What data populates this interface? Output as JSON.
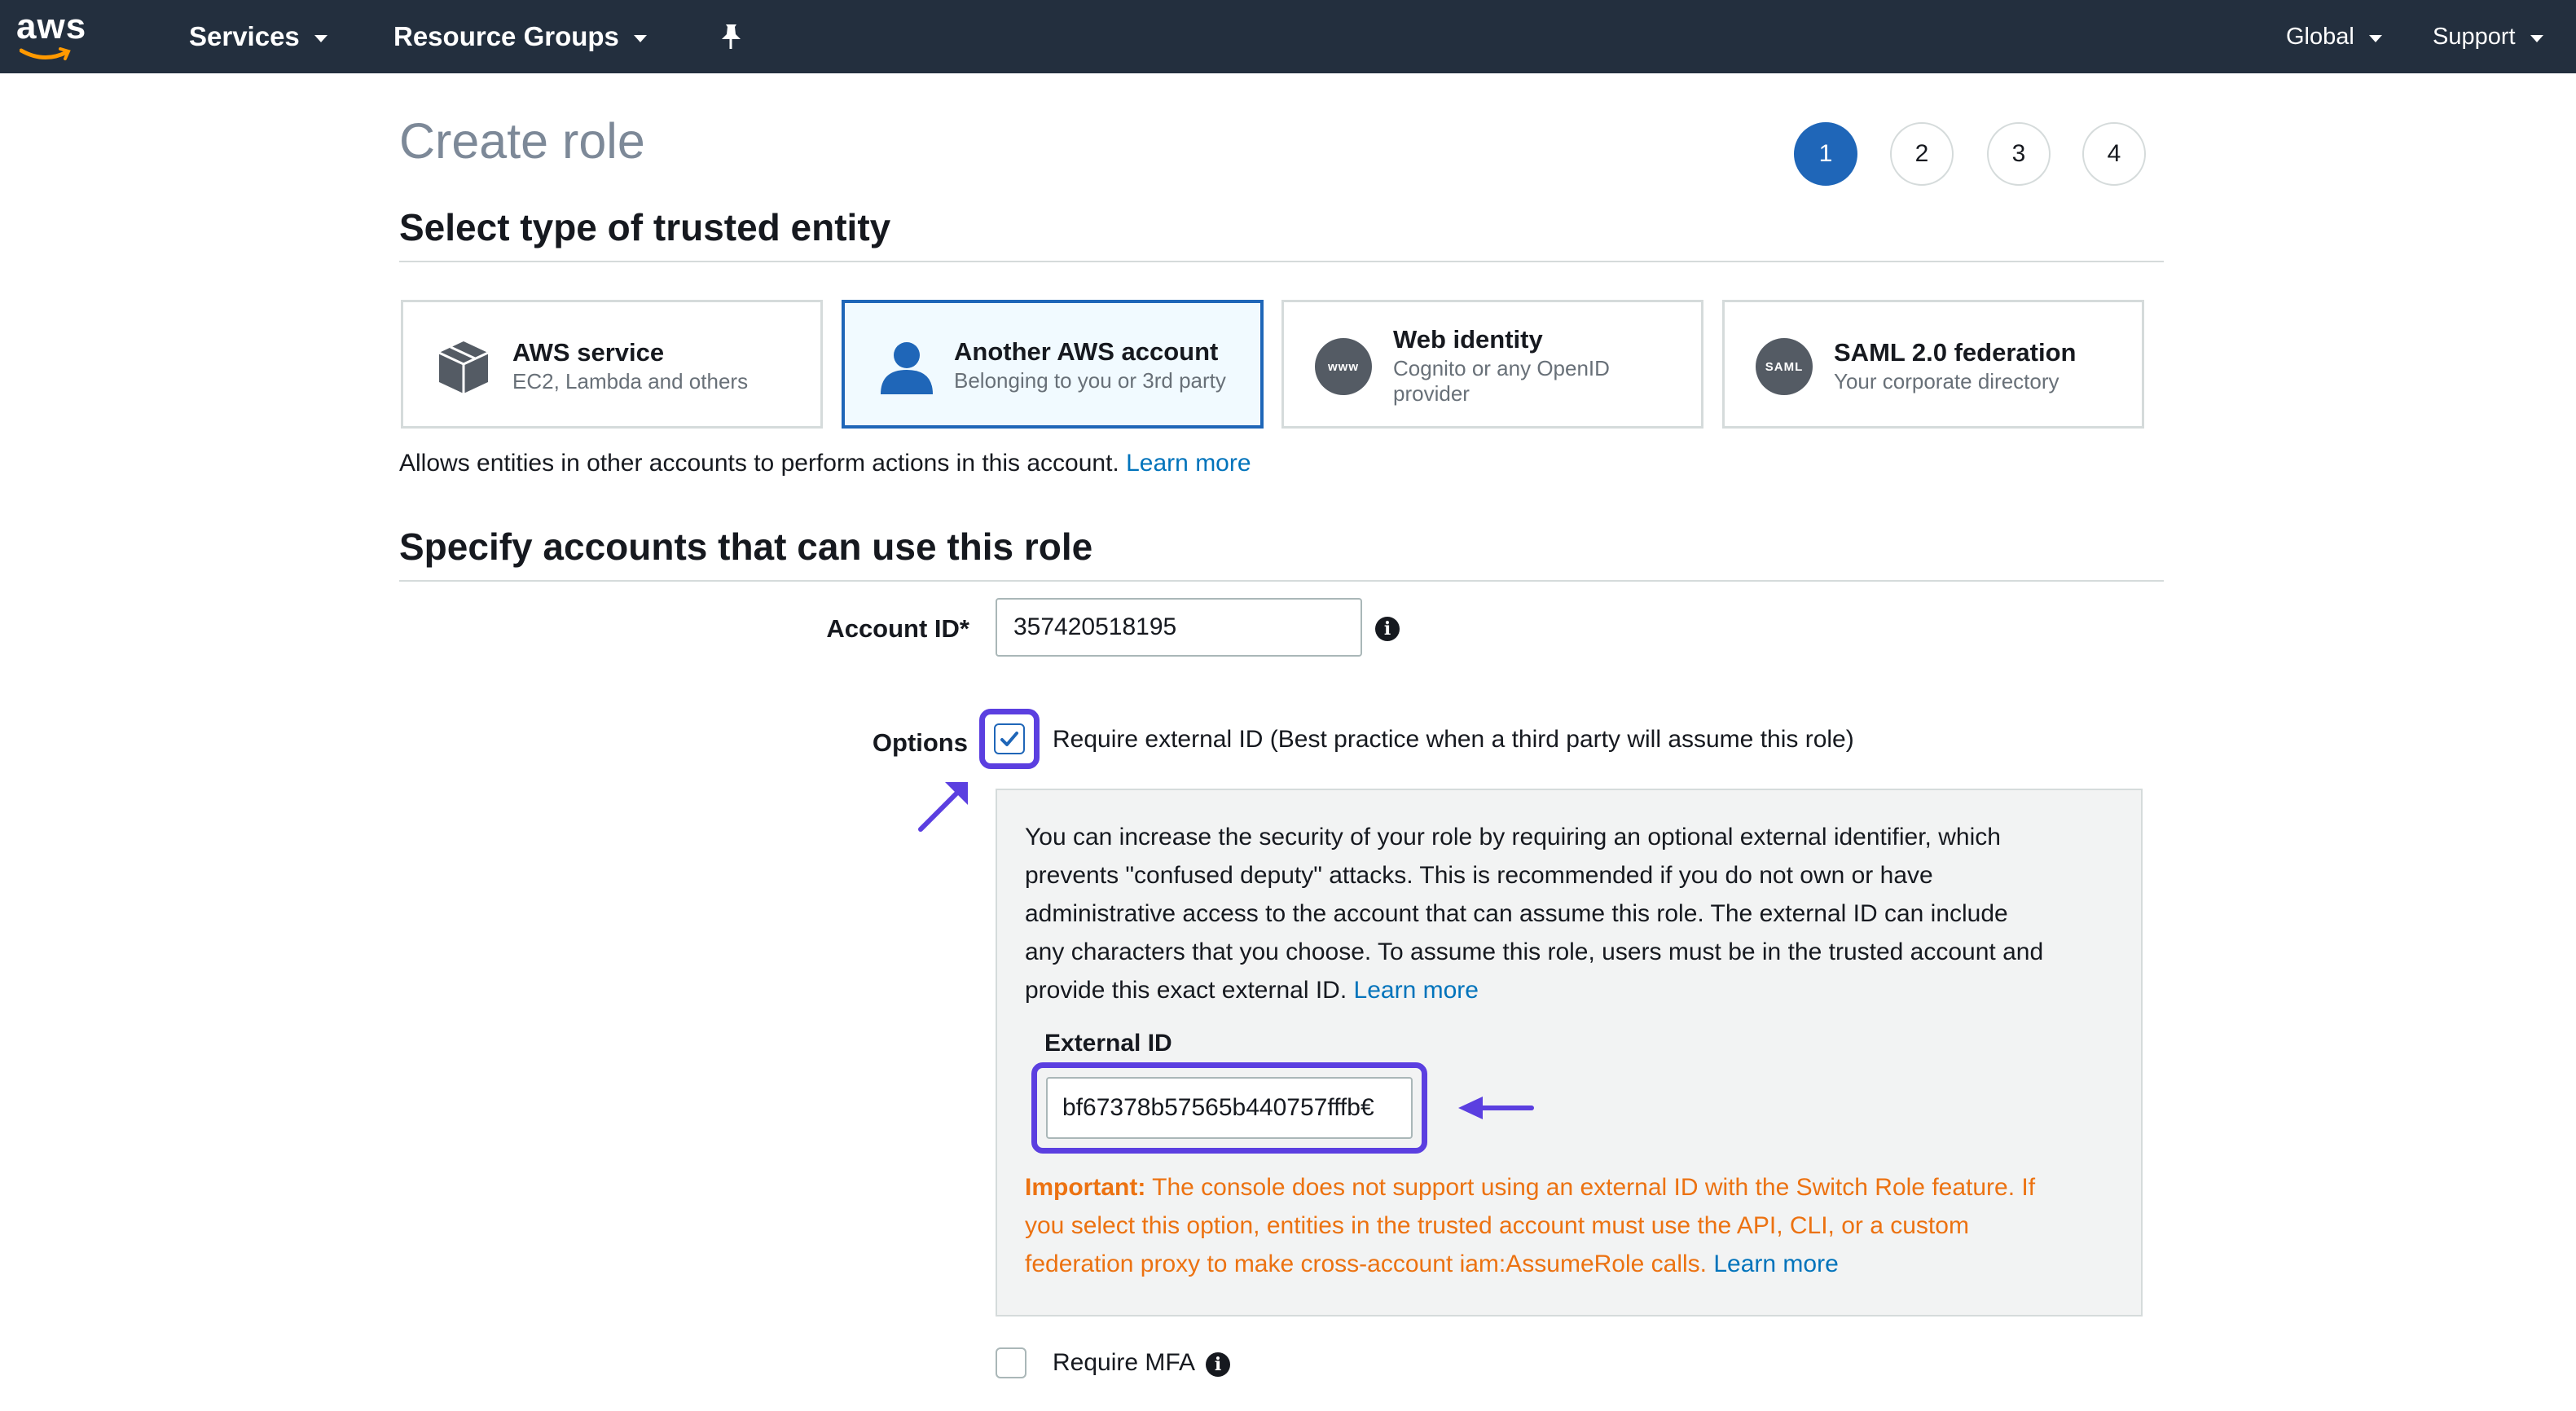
{
  "nav": {
    "logo": "aws",
    "services": "Services",
    "resource_groups": "Resource Groups",
    "pin_icon": "pin-icon",
    "global": "Global",
    "support": "Support"
  },
  "page": {
    "title": "Create role",
    "steps": [
      "1",
      "2",
      "3",
      "4"
    ],
    "active_step": "1"
  },
  "trusted_entity": {
    "heading": "Select type of trusted entity",
    "cards": [
      {
        "title": "AWS service",
        "subtitle": "EC2, Lambda and others",
        "icon": "cube-icon"
      },
      {
        "title": "Another AWS account",
        "subtitle": "Belonging to you or 3rd party",
        "icon": "user-icon"
      },
      {
        "title": "Web identity",
        "subtitle_line1": "Cognito or any OpenID",
        "subtitle_line2": "provider",
        "icon": "www-icon",
        "icon_text": "www"
      },
      {
        "title": "SAML 2.0 federation",
        "subtitle": "Your corporate directory",
        "icon": "saml-icon",
        "icon_text": "SAML"
      }
    ],
    "selected": "Another AWS account",
    "description": "Allows entities in other accounts to perform actions in this account.",
    "learn_more": "Learn more"
  },
  "accounts": {
    "heading": "Specify accounts that can use this role",
    "account_id_label": "Account ID*",
    "account_id_value": "357420518195",
    "options_label": "Options",
    "require_external_id": {
      "label": "Require external ID (Best practice when a third party will assume this role)",
      "checked": true
    },
    "info_lines": [
      "You can increase the security of your role by requiring an optional external identifier, which",
      "prevents \"confused deputy\" attacks. This is recommended if you do not own or have",
      "administrative access to the account that can assume this role. The external ID can include",
      "any characters that you choose. To assume this role, users must be in the trusted account and",
      "provide this exact external ID."
    ],
    "info_learn_more": "Learn more",
    "external_id_label": "External ID",
    "external_id_value": "bf67378b57565b440757fffb€",
    "important_label": "Important:",
    "important_lines": [
      " The console does not support using an external ID with the Switch Role feature. If",
      "you select this option, entities in the trusted account must use the API, CLI, or a custom",
      "federation proxy to make cross-account iam:AssumeRole calls."
    ],
    "important_learn_more": "Learn more",
    "require_mfa": {
      "label": "Require MFA",
      "checked": false
    }
  },
  "colors": {
    "nav_bg": "#232f3e",
    "link": "#0073bb",
    "selected": "#1f66b8",
    "warning": "#ec7211",
    "annotation": "#5b3fe0"
  }
}
